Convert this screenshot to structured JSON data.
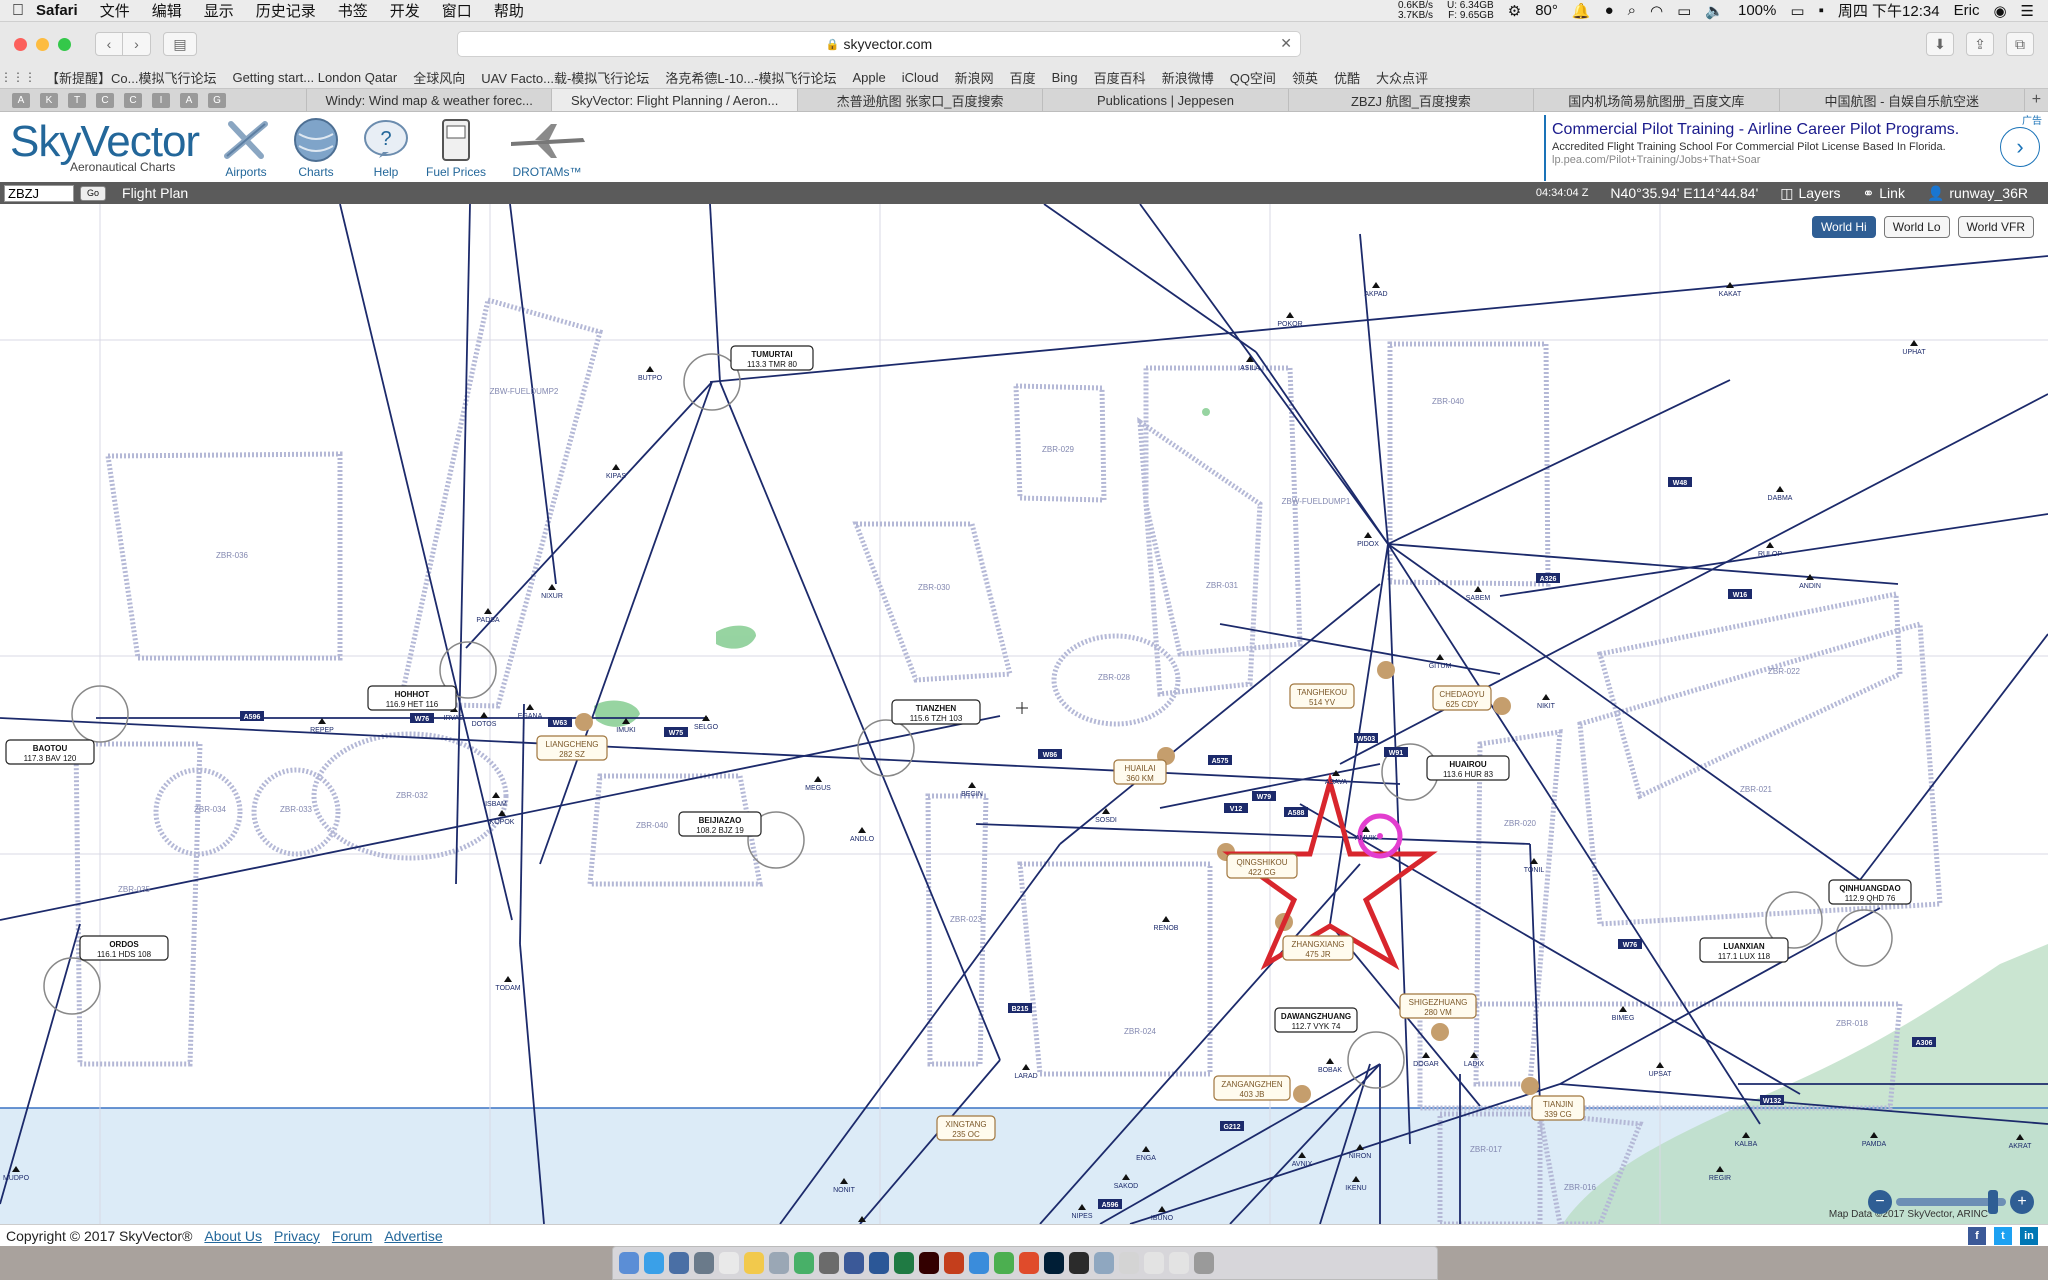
{
  "menubar": {
    "app_name": "Safari",
    "items": [
      "文件",
      "编辑",
      "显示",
      "历史记录",
      "书签",
      "开发",
      "窗口",
      "帮助"
    ],
    "net_up": "0.6KB/s",
    "net_down": "3.7KB/s",
    "mem_u": "U: 6.34GB",
    "mem_f": "F: 9.65GB",
    "temperature": "80°",
    "battery": "100%",
    "datetime": "周四 下午12:34",
    "user": "Eric"
  },
  "browser": {
    "url": "skyvector.com",
    "favorites": [
      "【新提醒】Co...模拟飞行论坛",
      "Getting start... London Qatar",
      "全球风向",
      "UAV Facto...载-模拟飞行论坛",
      "洛克希德L-10...-模拟飞行论坛",
      "Apple",
      "iCloud",
      "新浪网",
      "百度",
      "Bing",
      "百度百科",
      "新浪微博",
      "QQ空间",
      "领英",
      "优酷",
      "大众点评"
    ],
    "pinned_tabs": [
      "A",
      "K",
      "T",
      "C",
      "C",
      "I",
      "A",
      "G"
    ],
    "tabs": [
      {
        "label": "Windy: Wind map & weather forec...",
        "active": false
      },
      {
        "label": "SkyVector: Flight Planning / Aeron...",
        "active": true
      },
      {
        "label": "杰普逊航图 张家口_百度搜索",
        "active": false
      },
      {
        "label": "Publications | Jeppesen",
        "active": false
      },
      {
        "label": "ZBZJ 航图_百度搜索",
        "active": false
      },
      {
        "label": "国内机场简易航图册_百度文库",
        "active": false
      },
      {
        "label": "中国航图 - 自娱自乐航空迷",
        "active": false
      }
    ]
  },
  "skyvector": {
    "logo_text": "SkyVector",
    "logo_sub": "Aeronautical Charts",
    "nav": [
      {
        "label": "Airports",
        "icon": "airports-icon"
      },
      {
        "label": "Charts",
        "icon": "globe-icon"
      },
      {
        "label": "Help",
        "icon": "help-icon"
      },
      {
        "label": "Fuel Prices",
        "icon": "fuel-icon"
      },
      {
        "label": "DROTAMs™",
        "icon": "drone-icon"
      }
    ],
    "ad": {
      "title": "Commercial Pilot Training - Airline Career Pilot Programs.",
      "desc": "Accredited Flight Training School For Commercial Pilot License Based In Florida.",
      "url": "lp.pea.com/Pilot+Training/Jobs+That+Soar",
      "tag": "广告"
    }
  },
  "flight_plan_bar": {
    "input_value": "ZBZJ",
    "go_label": "Go",
    "label": "Flight Plan",
    "zulu_time": "04:34:04 Z",
    "coordinates": "N40°35.94' E114°44.84'",
    "layers": "Layers",
    "link": "Link",
    "user": "runway_36R"
  },
  "map": {
    "buttons": [
      {
        "label": "World Hi",
        "active": true
      },
      {
        "label": "World Lo",
        "active": false
      },
      {
        "label": "World VFR",
        "active": false
      }
    ],
    "data_credit": "Map Data ©2017 SkyVector, ARINC",
    "navaids": [
      {
        "name": "TUMURTAI",
        "freq": "113.3 TMR 80"
      },
      {
        "name": "HOHHOT",
        "freq": "116.9 HET 116"
      },
      {
        "name": "BAOTOU",
        "freq": "117.3 BAV 120"
      },
      {
        "name": "ORDOS",
        "freq": "116.1 HDS 108"
      },
      {
        "name": "BEIJIAZAO",
        "freq": "108.2 BJZ 19"
      },
      {
        "name": "TIANZHEN",
        "freq": "115.6 TZH 103"
      },
      {
        "name": "HUAIROU",
        "freq": "113.6 HUR 83"
      },
      {
        "name": "DAWANGZHUANG",
        "freq": "112.7 VYK 74"
      },
      {
        "name": "LUANXIAN",
        "freq": "117.1 LUX 118"
      },
      {
        "name": "QINHUANGDAO",
        "freq": "112.9 QHD 76"
      }
    ],
    "ndbs": [
      {
        "name": "LIANGCHENG",
        "freq": "282 SZ"
      },
      {
        "name": "TANGHEKOU",
        "freq": "514 YV"
      },
      {
        "name": "CHEDAOYU",
        "freq": "625 CDY"
      },
      {
        "name": "HUAILAI",
        "freq": "360 KM"
      },
      {
        "name": "QINGSHIKOU",
        "freq": "422 CG"
      },
      {
        "name": "ZHANGXIANG",
        "freq": "475 JR"
      },
      {
        "name": "SHIGEZHUANG",
        "freq": "280 VM"
      },
      {
        "name": "ZANGANGZHEN",
        "freq": "403 JB"
      },
      {
        "name": "TIANJIN",
        "freq": "339 CG"
      },
      {
        "name": "XINGTANG",
        "freq": "235 OC"
      }
    ],
    "zones": [
      "ZBR-036",
      "ZBW-FUELDUMP2",
      "ZBR-029",
      "ZBW-FUELDUMP1",
      "ZBR-040",
      "ZBR-030",
      "ZBR-031",
      "ZBR-028",
      "ZBR-022",
      "ZBR-034",
      "ZBR-033",
      "ZBR-032",
      "ZBR-035",
      "ZBR-040",
      "ZBR-023",
      "ZBR-024",
      "ZBR-020",
      "ZBR-021",
      "ZBR-018",
      "ZBR-017",
      "ZBR-016"
    ],
    "fixes": [
      "BUTPO",
      "KIPAS",
      "AKPAD",
      "POKOR",
      "ASILA",
      "KAKAT",
      "UPHAT",
      "PIDOX",
      "SABEM",
      "DABMA",
      "RULOP",
      "ANDIN",
      "NIXUR",
      "PADSA",
      "REPEP",
      "IRVAG",
      "DOTOS",
      "EGANA",
      "IMUKI",
      "SELGO",
      "MEGUS",
      "ANDLO",
      "BEGIN",
      "SOSDI",
      "GITUM",
      "NIKIT",
      "ASAVA",
      "AMVIK",
      "TONIL",
      "RENOB",
      "TODAM",
      "LARAD",
      "BIMEG",
      "LADIX",
      "DOGAR",
      "BOBAK",
      "UPSAT",
      "KALBA",
      "PAMDA",
      "NONIT",
      "SAKOD",
      "ENGA",
      "IBUNO",
      "NIPES",
      "PIGAN",
      "AVNIX",
      "MUDPO",
      "AKRAT",
      "REGIR",
      "NIRON",
      "IKENU",
      "ISBAM",
      "KOPOK"
    ],
    "airways": [
      "A596",
      "W76",
      "W63",
      "W75",
      "W86",
      "A575",
      "W79",
      "W91",
      "W16",
      "W48",
      "A326",
      "A588",
      "V12",
      "W503",
      "A306",
      "W132",
      "G212",
      "B215"
    ]
  },
  "footer": {
    "copyright": "Copyright © 2017 SkyVector®",
    "links": [
      "About Us",
      "Privacy",
      "Forum",
      "Advertise"
    ]
  },
  "colors": {
    "airway": "#1c2a6b",
    "restricted_zone": "#b4b8d6",
    "sea": "#dcebf7",
    "land_green": "#7dc98a",
    "highlight_star": "#d8262d",
    "highlight_circle": "#e23ecf",
    "chart_accent": "#23679a"
  }
}
